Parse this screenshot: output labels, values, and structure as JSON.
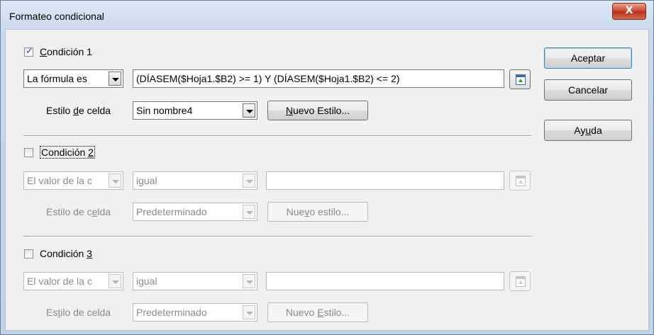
{
  "window": {
    "title": "Formateo condicional",
    "close_glyph": "X"
  },
  "conditions": [
    {
      "checked": true,
      "label_pre": "",
      "label_u": "C",
      "label_post": "ondición 1",
      "type_value": "La fórmula es",
      "operator_value": "",
      "formula_value": "(DÍASEM($Hoja1.$B2) >= 1)  Y  (DÍASEM($Hoja1.$B2) <= 2)",
      "style_label_pre": "Estilo ",
      "style_label_u": "d",
      "style_label_post": "e celda",
      "style_value": "Sin nombre4",
      "new_style_pre": "",
      "new_style_u": "N",
      "new_style_post": "uevo Estilo..."
    },
    {
      "checked": false,
      "label_pre": "Condición ",
      "label_u": "2",
      "label_post": "",
      "type_value": "El valor de la c",
      "operator_value": "igual",
      "formula_value": "",
      "style_label_pre": "Estilo de c",
      "style_label_u": "e",
      "style_label_post": "lda",
      "style_value": "Predeterminado",
      "new_style_pre": "Nue",
      "new_style_u": "v",
      "new_style_post": "o estilo..."
    },
    {
      "checked": false,
      "label_pre": "Condición ",
      "label_u": "3",
      "label_post": "",
      "type_value": "El valor de la c",
      "operator_value": "igual",
      "formula_value": "",
      "style_label_pre": "Es",
      "style_label_u": "t",
      "style_label_post": "ilo de celda",
      "style_value": "Predeterminado",
      "new_style_pre": "Nuevo ",
      "new_style_u": "E",
      "new_style_post": "stilo..."
    }
  ],
  "buttons": {
    "ok": "Aceptar",
    "cancel": "Cancelar",
    "help_pre": "Ay",
    "help_u": "u",
    "help_post": "da"
  },
  "icons": {
    "checkbox_mark": "✓",
    "close": "close-icon",
    "shrink": "shrink-dialog-icon",
    "dropdown": "chevron-down-icon"
  },
  "colors": {
    "title_bg": "#c8d9ec",
    "dialog_bg": "#f0f0f0",
    "close_button": "#c8452f",
    "default_button_border": "#3c7fb1"
  }
}
